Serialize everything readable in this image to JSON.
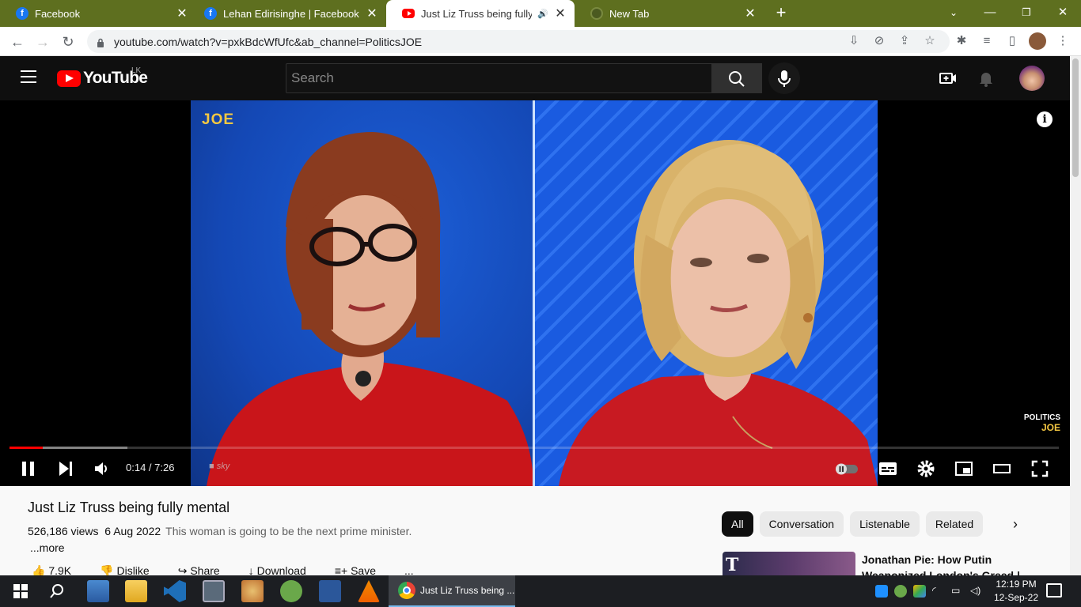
{
  "browser": {
    "tabs": [
      {
        "title": "Facebook",
        "icon": "facebook-icon",
        "active": false
      },
      {
        "title": "Lehan Edirisinghe | Facebook",
        "icon": "facebook-icon",
        "active": false
      },
      {
        "title": "Just Liz Truss being fully mer",
        "icon": "youtube-icon",
        "active": true
      },
      {
        "title": "New Tab",
        "icon": "globe-icon",
        "active": false
      }
    ],
    "url": "youtube.com/watch?v=pxkBdcWfUfc&ab_channel=PoliticsJOE"
  },
  "youtube": {
    "logo_text": "YouTube",
    "country_code": "LK",
    "search_placeholder": "Search"
  },
  "player": {
    "channel_bug": "JOE",
    "watermark_top": "POLITICS",
    "watermark_bottom": "JOE",
    "info_glyph": "i",
    "time": "0:14 / 7:26",
    "broadcaster": "sky",
    "progress_played": 0.032,
    "progress_buffered": 0.112
  },
  "video": {
    "title": "Just Liz Truss being fully mental",
    "views": "526,186 views",
    "date": "6 Aug 2022",
    "description": "This woman is going to be the next prime minister.",
    "more": "...more",
    "likes": "7.9K",
    "dislike": "Dislike",
    "share": "Share",
    "download": "Download",
    "save": "Save",
    "overflow": "..."
  },
  "chips": [
    "All",
    "Conversation",
    "Listenable",
    "Related"
  ],
  "recommendation": {
    "thumb_text": "T",
    "title": "Jonathan Pie: How Putin Weaponized London's Greed |"
  },
  "taskbar": {
    "active_window": "Just Liz Truss being ...",
    "time": "12:19 PM",
    "date": "12-Sep-22"
  },
  "colors": {
    "accent_red": "#ff0000",
    "tab_bar": "#5e6f1f",
    "yt_dark": "#0f0f0f"
  }
}
